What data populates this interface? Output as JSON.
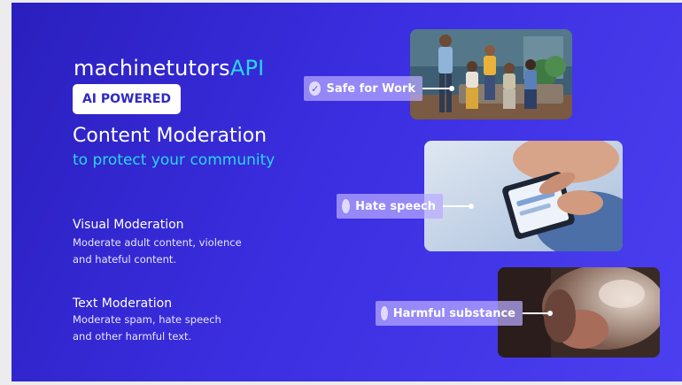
{
  "brand": {
    "name": "machinetutors",
    "suffix": "API"
  },
  "badge": "AI POWERED",
  "headline": "Content Moderation",
  "subheadline": "to protect your community",
  "features": [
    {
      "title": "Visual Moderation",
      "desc_line1": "Moderate adult content, violence",
      "desc_line2": "and hateful content."
    },
    {
      "title": "Text Moderation",
      "desc_line1": "Moderate spam, hate speech",
      "desc_line2": "and other harmful text."
    }
  ],
  "tags": [
    {
      "label": "Safe for Work",
      "icon": "check-circle-icon"
    },
    {
      "label": "Hate speech",
      "icon": "circle-icon"
    },
    {
      "label": "Harmful substance",
      "icon": "circle-icon"
    }
  ],
  "colors": {
    "background": "#3a2ee0",
    "accent": "#2ad7f0",
    "badge_text": "#2e2ac2",
    "tag_bg": "#b8aaff"
  }
}
